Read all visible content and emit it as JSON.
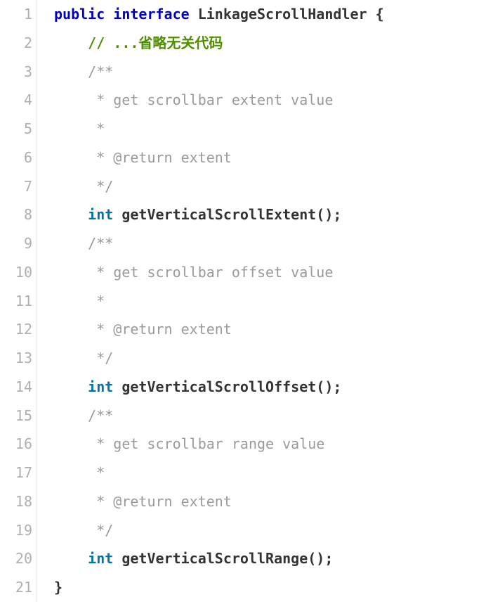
{
  "lines": [
    {
      "num": "1",
      "tokens": [
        {
          "cls": "kw",
          "t": "public"
        },
        {
          "cls": "thin",
          "t": " "
        },
        {
          "cls": "kw",
          "t": "interface"
        },
        {
          "cls": "thin",
          "t": " "
        },
        {
          "cls": "id",
          "t": "LinkageScrollHandler"
        },
        {
          "cls": "thin",
          "t": " "
        },
        {
          "cls": "pn",
          "t": "{"
        }
      ]
    },
    {
      "num": "2",
      "indent": "    ",
      "tokens": [
        {
          "cls": "cm",
          "t": "// ...省略无关代码"
        }
      ]
    },
    {
      "num": "3",
      "indent": "    ",
      "tokens": [
        {
          "cls": "doc",
          "t": "/**"
        }
      ]
    },
    {
      "num": "4",
      "indent": "    ",
      "tokens": [
        {
          "cls": "doc",
          "t": " * get scrollbar extent value"
        }
      ]
    },
    {
      "num": "5",
      "indent": "    ",
      "tokens": [
        {
          "cls": "doc",
          "t": " *"
        }
      ]
    },
    {
      "num": "6",
      "indent": "    ",
      "tokens": [
        {
          "cls": "doc",
          "t": " * @return extent"
        }
      ]
    },
    {
      "num": "7",
      "indent": "    ",
      "tokens": [
        {
          "cls": "doc",
          "t": " */"
        }
      ]
    },
    {
      "num": "8",
      "indent": "    ",
      "tokens": [
        {
          "cls": "type",
          "t": "int"
        },
        {
          "cls": "thin",
          "t": " "
        },
        {
          "cls": "id",
          "t": "getVerticalScrollExtent"
        },
        {
          "cls": "pn",
          "t": "();"
        }
      ]
    },
    {
      "num": "9",
      "indent": "    ",
      "tokens": [
        {
          "cls": "doc",
          "t": "/**"
        }
      ]
    },
    {
      "num": "10",
      "indent": "    ",
      "tokens": [
        {
          "cls": "doc",
          "t": " * get scrollbar offset value"
        }
      ]
    },
    {
      "num": "11",
      "indent": "    ",
      "tokens": [
        {
          "cls": "doc",
          "t": " *"
        }
      ]
    },
    {
      "num": "12",
      "indent": "    ",
      "tokens": [
        {
          "cls": "doc",
          "t": " * @return extent"
        }
      ]
    },
    {
      "num": "13",
      "indent": "    ",
      "tokens": [
        {
          "cls": "doc",
          "t": " */"
        }
      ]
    },
    {
      "num": "14",
      "indent": "    ",
      "tokens": [
        {
          "cls": "type",
          "t": "int"
        },
        {
          "cls": "thin",
          "t": " "
        },
        {
          "cls": "id",
          "t": "getVerticalScrollOffset"
        },
        {
          "cls": "pn",
          "t": "();"
        }
      ]
    },
    {
      "num": "15",
      "indent": "    ",
      "tokens": [
        {
          "cls": "doc",
          "t": "/**"
        }
      ]
    },
    {
      "num": "16",
      "indent": "    ",
      "tokens": [
        {
          "cls": "doc",
          "t": " * get scrollbar range value"
        }
      ]
    },
    {
      "num": "17",
      "indent": "    ",
      "tokens": [
        {
          "cls": "doc",
          "t": " *"
        }
      ]
    },
    {
      "num": "18",
      "indent": "    ",
      "tokens": [
        {
          "cls": "doc",
          "t": " * @return extent"
        }
      ]
    },
    {
      "num": "19",
      "indent": "    ",
      "tokens": [
        {
          "cls": "doc",
          "t": " */"
        }
      ]
    },
    {
      "num": "20",
      "indent": "    ",
      "tokens": [
        {
          "cls": "type",
          "t": "int"
        },
        {
          "cls": "thin",
          "t": " "
        },
        {
          "cls": "id",
          "t": "getVerticalScrollRange"
        },
        {
          "cls": "pn",
          "t": "();"
        }
      ]
    },
    {
      "num": "21",
      "tokens": [
        {
          "cls": "pn",
          "t": "}"
        }
      ]
    }
  ]
}
